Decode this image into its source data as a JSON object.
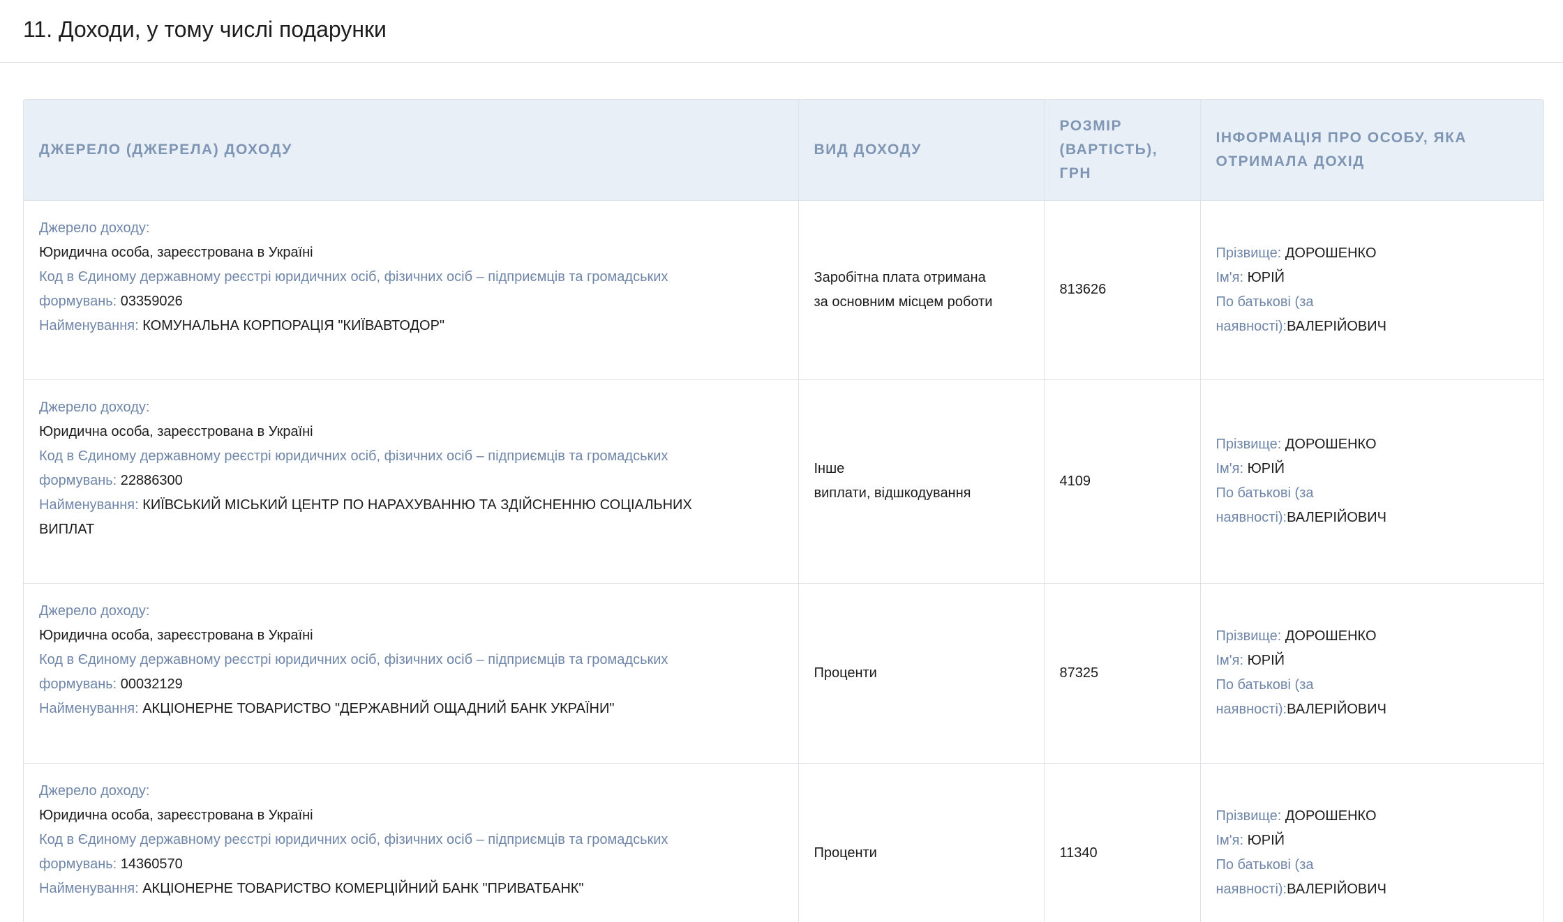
{
  "section": {
    "title": "11. Доходи, у тому числі подарунки"
  },
  "table": {
    "headers": {
      "source": "ДЖЕРЕЛО (ДЖЕРЕЛА) ДОХОДУ",
      "type": "ВИД ДОХОДУ",
      "amount": [
        "РОЗМІР",
        "(ВАРТІСТЬ),",
        "ГРН"
      ],
      "person": [
        "ІНФОРМАЦІЯ ПРО ОСОБУ, ЯКА",
        "ОТРИМАЛА ДОХІД"
      ]
    },
    "labels": {
      "source_label": "Джерело доходу:",
      "code_label_1": "Код в Єдиному державному реєстрі юридичних осіб, фізичних осіб – підприємців та громадських",
      "code_label_2": "формувань: ",
      "name_label": "Найменування: ",
      "surname_label": "Прізвище: ",
      "firstname_label": "Ім'я: ",
      "patronymic_label_1": "По батькові (за",
      "patronymic_label_2": "наявності):"
    },
    "rows": [
      {
        "source_type": "Юридична особа, зареєстрована в Україні",
        "code": "03359026",
        "name_1": "КОМУНАЛЬНА КОРПОРАЦІЯ \"КИЇВАВТОДОР\"",
        "name_2": "",
        "income_type_1": "Заробітна плата отримана",
        "income_type_2": "за основним місцем роботи",
        "amount": "813626",
        "surname": "ДОРОШЕНКО",
        "firstname": "ЮРІЙ",
        "patronymic": "ВАЛЕРІЙОВИЧ"
      },
      {
        "source_type": "Юридична особа, зареєстрована в Україні",
        "code": "22886300",
        "name_1": "КИЇВСЬКИЙ МІСЬКИЙ ЦЕНТР ПО НАРАХУВАННЮ ТА ЗДІЙСНЕННЮ СОЦІАЛЬНИХ",
        "name_2": "ВИПЛАТ",
        "income_type_1": "Інше",
        "income_type_2": "виплати, відшкодування",
        "amount": "4109",
        "surname": "ДОРОШЕНКО",
        "firstname": "ЮРІЙ",
        "patronymic": "ВАЛЕРІЙОВИЧ"
      },
      {
        "source_type": "Юридична особа, зареєстрована в Україні",
        "code": "00032129",
        "name_1": "АКЦІОНЕРНЕ ТОВАРИСТВО \"ДЕРЖАВНИЙ ОЩАДНИЙ БАНК УКРАЇНИ\"",
        "name_2": "",
        "income_type_1": "Проценти",
        "income_type_2": "",
        "amount": "87325",
        "surname": "ДОРОШЕНКО",
        "firstname": "ЮРІЙ",
        "patronymic": "ВАЛЕРІЙОВИЧ"
      },
      {
        "source_type": "Юридична особа, зареєстрована в Україні",
        "code": "14360570",
        "name_1": "АКЦІОНЕРНЕ ТОВАРИСТВО КОМЕРЦІЙНИЙ БАНК \"ПРИВАТБАНК\"",
        "name_2": "",
        "income_type_1": "Проценти",
        "income_type_2": "",
        "amount": "11340",
        "surname": "ДОРОШЕНКО",
        "firstname": "ЮРІЙ",
        "patronymic": "ВАЛЕРІЙОВИЧ"
      }
    ]
  }
}
